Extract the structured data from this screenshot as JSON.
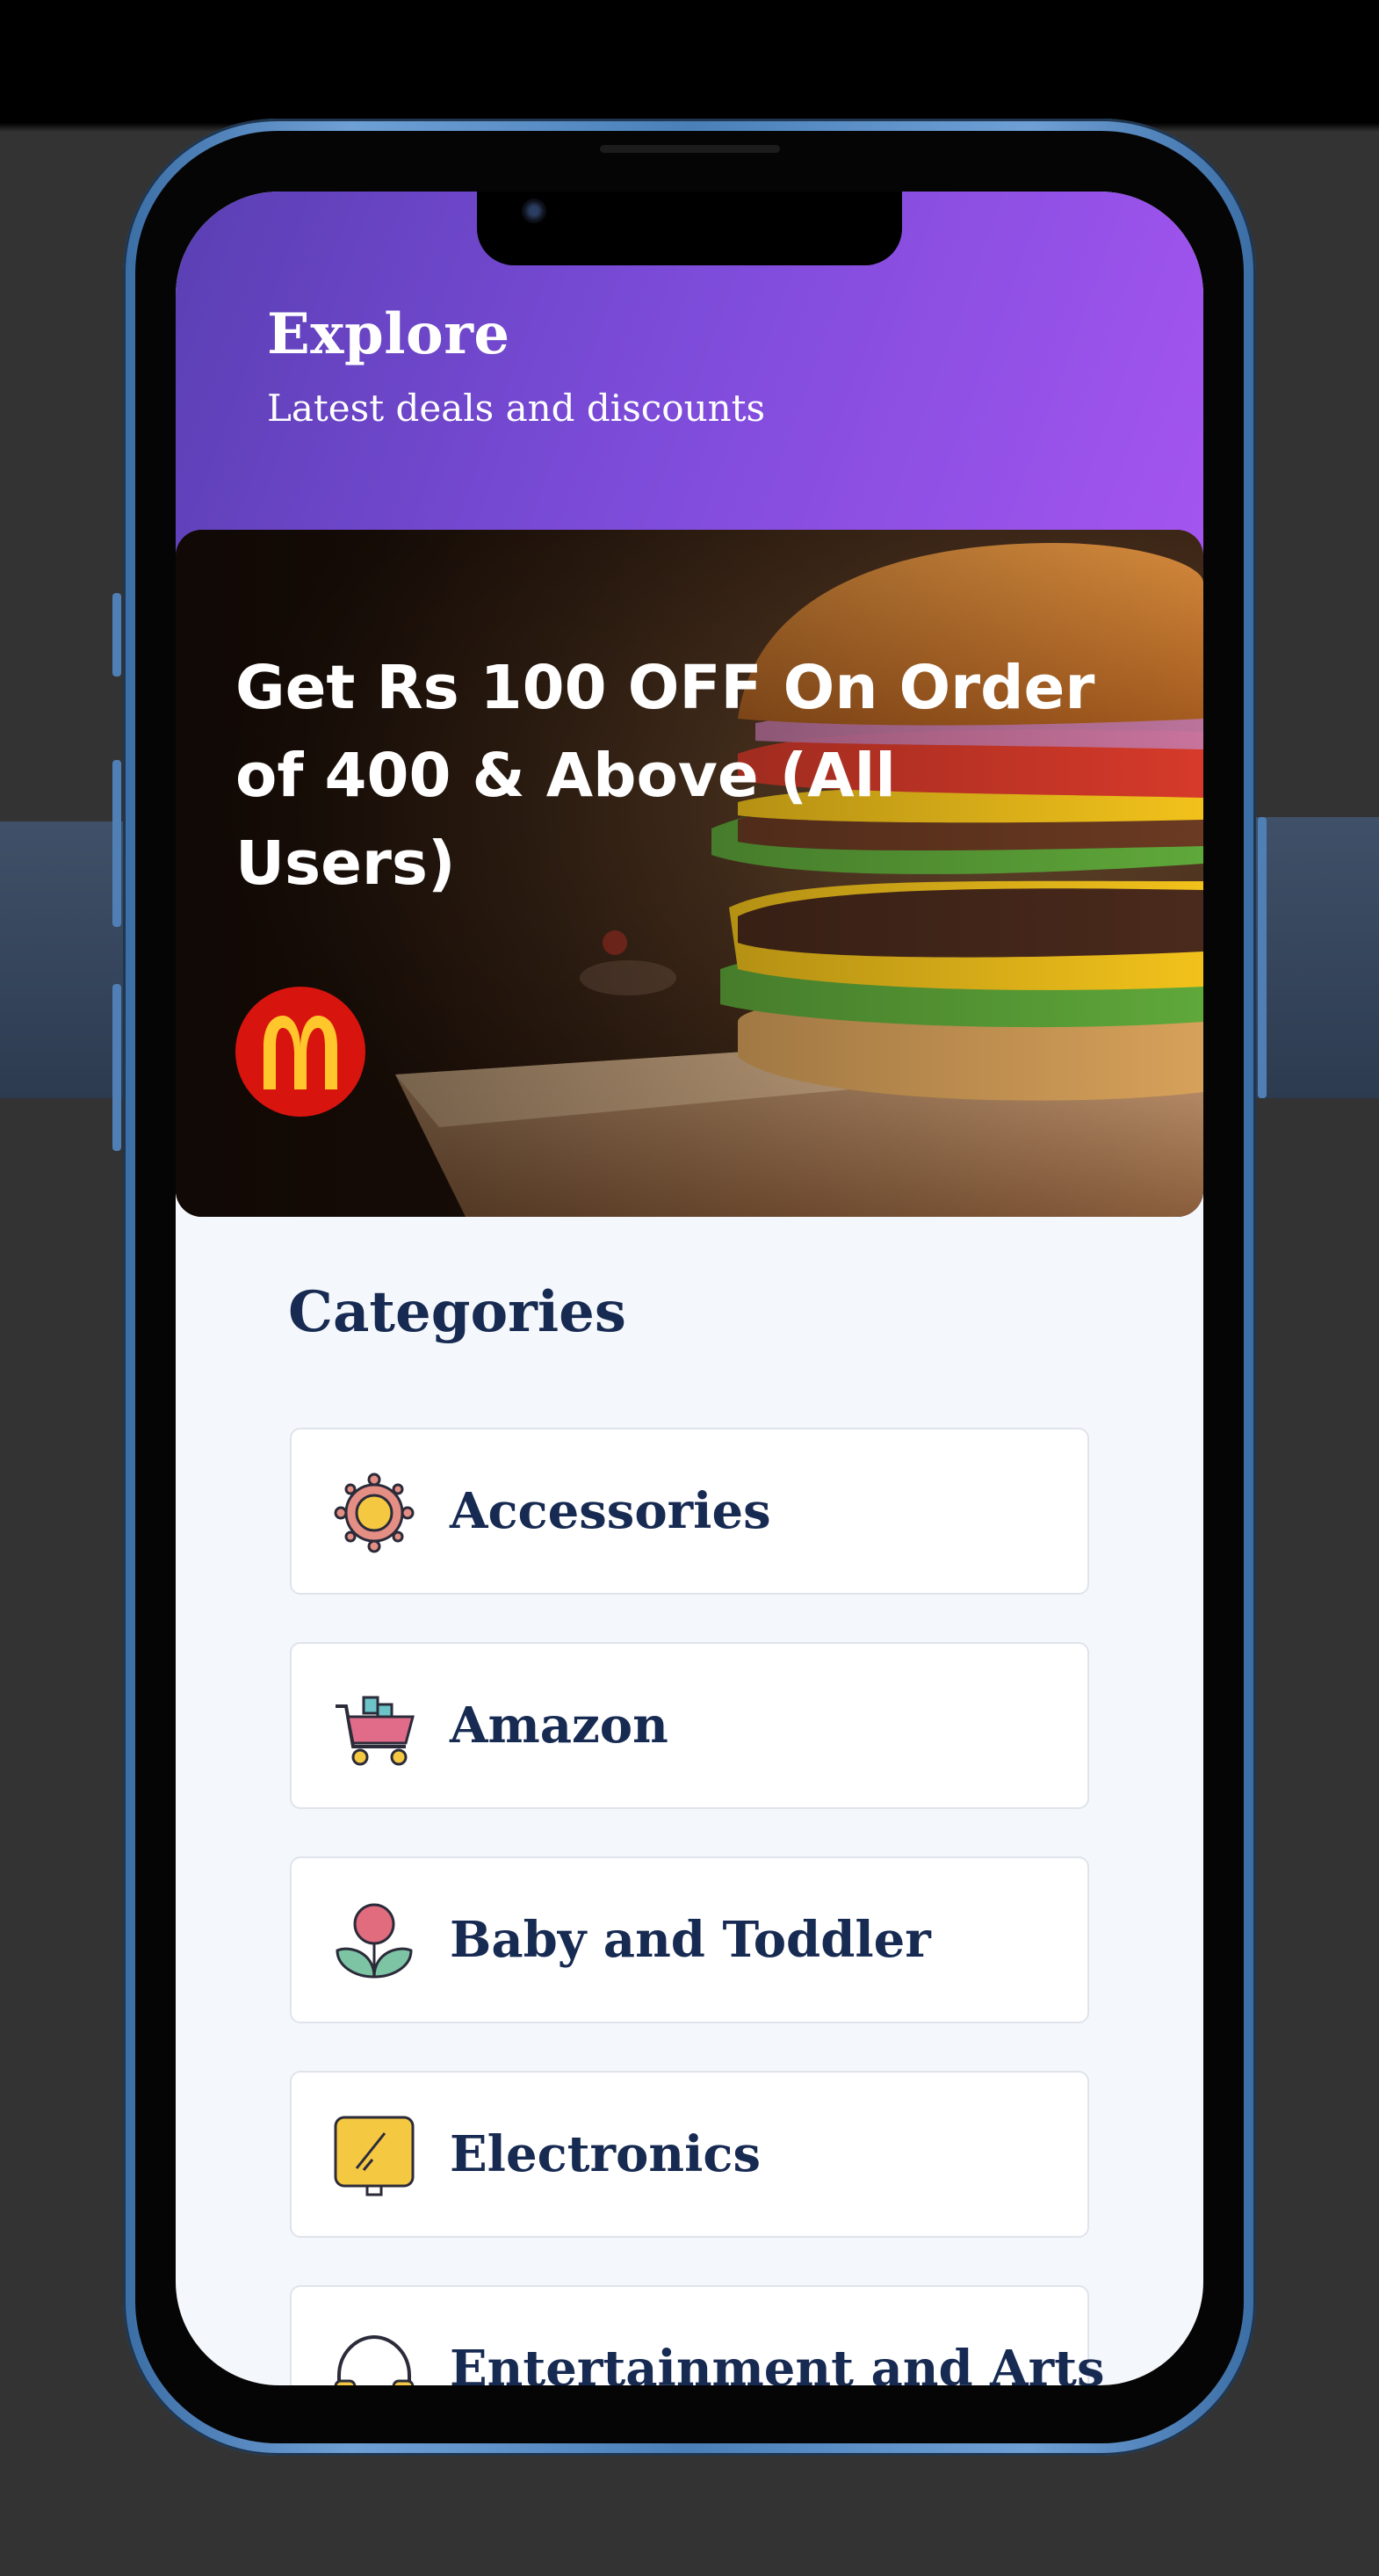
{
  "header": {
    "title": "Explore",
    "subtitle": "Latest deals and discounts"
  },
  "banner": {
    "title": "Get Rs 100 OFF On Order of 400 & Above (All Users)",
    "brand_logo_icon": "mcdonalds-logo"
  },
  "categories": {
    "title": "Categories",
    "items": [
      {
        "label": "Accessories",
        "icon": "sun-wheel-icon"
      },
      {
        "label": "Amazon",
        "icon": "shopping-cart-icon"
      },
      {
        "label": "Baby and Toddler",
        "icon": "flower-icon"
      },
      {
        "label": "Electronics",
        "icon": "tablet-icon"
      },
      {
        "label": "Entertainment and Arts",
        "icon": "headphones-icon"
      }
    ]
  },
  "colors": {
    "header_gradient_start": "#5a3fb3",
    "header_gradient_end": "#a455f0",
    "category_text": "#172a52",
    "screen_background": "#f4f7fb",
    "phone_frame": "#4a7fb8",
    "mcdonalds_red": "#d8140e",
    "mcdonalds_yellow": "#ffc72c"
  }
}
